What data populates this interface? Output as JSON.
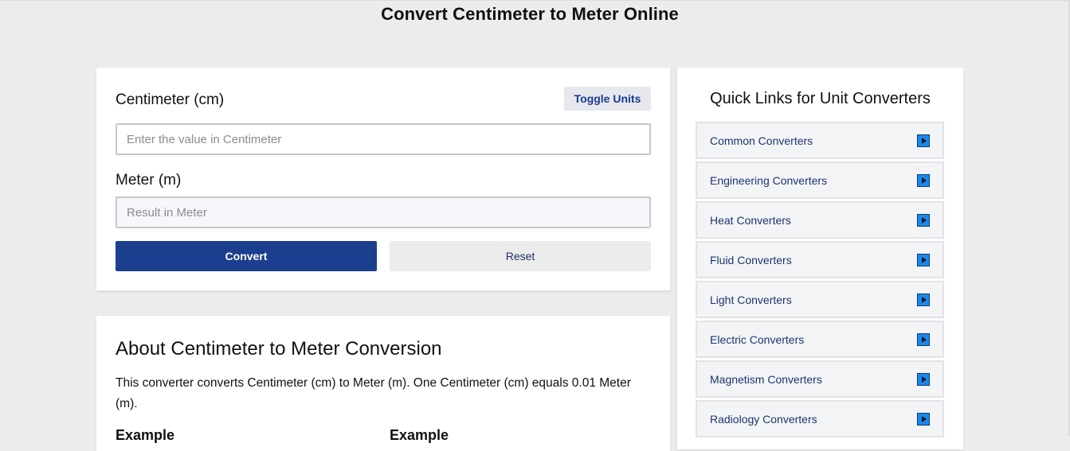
{
  "page": {
    "title": "Convert Centimeter to Meter Online"
  },
  "converter": {
    "from_label": "Centimeter (cm)",
    "to_label": "Meter (m)",
    "toggle_label": "Toggle Units",
    "from_input": {
      "value": "",
      "placeholder": "Enter the value in Centimeter"
    },
    "to_input": {
      "value": "",
      "placeholder": "Result in Meter"
    },
    "convert_label": "Convert",
    "reset_label": "Reset"
  },
  "about": {
    "title": "About Centimeter to Meter Conversion",
    "text": "This converter converts Centimeter (cm) to Meter (m). One Centimeter (cm) equals 0.01 Meter (m).",
    "example_left": "Example",
    "example_right": "Example"
  },
  "quick_links": {
    "title": "Quick Links for Unit Converters",
    "items": [
      {
        "label": "Common Converters"
      },
      {
        "label": "Engineering Converters"
      },
      {
        "label": "Heat Converters"
      },
      {
        "label": "Fluid Converters"
      },
      {
        "label": "Light Converters"
      },
      {
        "label": "Electric Converters"
      },
      {
        "label": "Magnetism Converters"
      },
      {
        "label": "Radiology Converters"
      }
    ],
    "icon": "play-icon"
  },
  "colors": {
    "primary": "#1c3e8e",
    "background": "#ececec",
    "link_text": "#1c3570",
    "icon_fill": "#1e88e5"
  }
}
